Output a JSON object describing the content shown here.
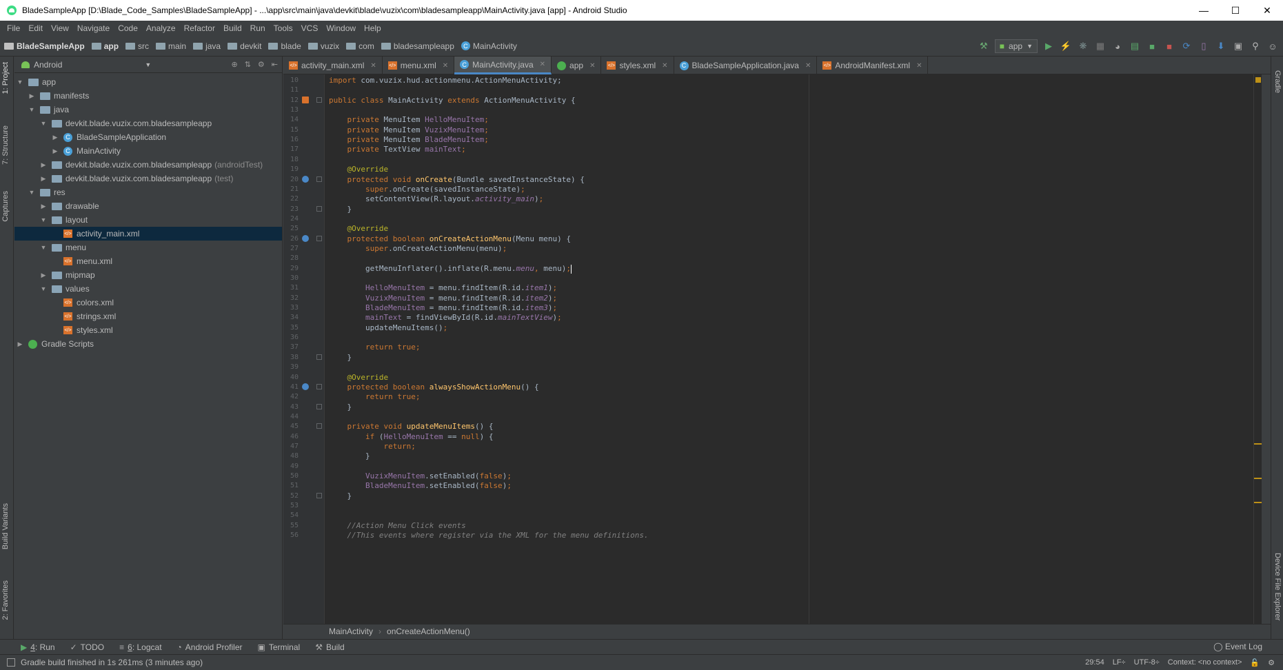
{
  "window": {
    "title": "BladeSampleApp [D:\\Blade_Code_Samples\\BladeSampleApp] - ...\\app\\src\\main\\java\\devkit\\blade\\vuzix\\com\\bladesampleapp\\MainActivity.java [app] - Android Studio",
    "minimize": "—",
    "maximize": "☐",
    "close": "✕"
  },
  "menu": [
    "File",
    "Edit",
    "View",
    "Navigate",
    "Code",
    "Analyze",
    "Refactor",
    "Build",
    "Run",
    "Tools",
    "VCS",
    "Window",
    "Help"
  ],
  "breadcrumbs": [
    "BladeSampleApp",
    "app",
    "src",
    "main",
    "java",
    "devkit",
    "blade",
    "vuzix",
    "com",
    "bladesampleapp",
    "MainActivity"
  ],
  "toolbar": {
    "run_config": "app"
  },
  "left_tool_tabs": [
    "1: Project",
    "7: Structure",
    "Captures",
    "Build Variants",
    "2: Favorites"
  ],
  "right_tool_tabs": [
    "Gradle",
    "Device File Explorer"
  ],
  "project": {
    "view_mode": "Android",
    "tree": [
      {
        "label": "app",
        "depth": 0,
        "type": "folder",
        "open": true
      },
      {
        "label": "manifests",
        "depth": 1,
        "type": "folder",
        "open": false
      },
      {
        "label": "java",
        "depth": 1,
        "type": "folder",
        "open": true
      },
      {
        "label": "devkit.blade.vuzix.com.bladesampleapp",
        "depth": 2,
        "type": "pkg",
        "open": true
      },
      {
        "label": "BladeSampleApplication",
        "depth": 3,
        "type": "class",
        "open": false
      },
      {
        "label": "MainActivity",
        "depth": 3,
        "type": "class",
        "open": false
      },
      {
        "label": "devkit.blade.vuzix.com.bladesampleapp",
        "suffix": "(androidTest)",
        "depth": 2,
        "type": "pkg",
        "open": false
      },
      {
        "label": "devkit.blade.vuzix.com.bladesampleapp",
        "suffix": "(test)",
        "depth": 2,
        "type": "pkg",
        "open": false
      },
      {
        "label": "res",
        "depth": 1,
        "type": "folder",
        "open": true
      },
      {
        "label": "drawable",
        "depth": 2,
        "type": "folder",
        "open": false
      },
      {
        "label": "layout",
        "depth": 2,
        "type": "folder",
        "open": true
      },
      {
        "label": "activity_main.xml",
        "depth": 3,
        "type": "xml",
        "selected": true
      },
      {
        "label": "menu",
        "depth": 2,
        "type": "folder",
        "open": true
      },
      {
        "label": "menu.xml",
        "depth": 3,
        "type": "xml"
      },
      {
        "label": "mipmap",
        "depth": 2,
        "type": "folder",
        "open": false
      },
      {
        "label": "values",
        "depth": 2,
        "type": "folder",
        "open": true
      },
      {
        "label": "colors.xml",
        "depth": 3,
        "type": "xml"
      },
      {
        "label": "strings.xml",
        "depth": 3,
        "type": "xml"
      },
      {
        "label": "styles.xml",
        "depth": 3,
        "type": "xml"
      },
      {
        "label": "Gradle Scripts",
        "depth": 0,
        "type": "gradle",
        "open": false
      }
    ]
  },
  "editor_tabs": [
    {
      "label": "activity_main.xml",
      "icon": "xml"
    },
    {
      "label": "menu.xml",
      "icon": "xml"
    },
    {
      "label": "MainActivity.java",
      "icon": "class",
      "active": true
    },
    {
      "label": "app",
      "icon": "gradle"
    },
    {
      "label": "styles.xml",
      "icon": "xml"
    },
    {
      "label": "BladeSampleApplication.java",
      "icon": "class"
    },
    {
      "label": "AndroidManifest.xml",
      "icon": "xml"
    }
  ],
  "code_lines": [
    {
      "n": "10",
      "html": "<span class='kw'>import</span> <span class='tx'>com.vuzix.hud.actionmenu.ActionMenuActivity;</span>"
    },
    {
      "n": "11",
      "html": ""
    },
    {
      "n": "12",
      "html": "<span class='kw'>public class</span> <span class='tx'>MainActivity</span> <span class='kw'>extends</span> <span class='tx'>ActionMenuActivity {</span>"
    },
    {
      "n": "13",
      "html": ""
    },
    {
      "n": "14",
      "html": "    <span class='kw'>private</span> <span class='tx'>MenuItem</span> <span class='fld'>HelloMenuItem</span><span class='kw'>;</span>"
    },
    {
      "n": "15",
      "html": "    <span class='kw'>private</span> <span class='tx'>MenuItem</span> <span class='fld'>VuzixMenuItem</span><span class='kw'>;</span>"
    },
    {
      "n": "16",
      "html": "    <span class='kw'>private</span> <span class='tx'>MenuItem</span> <span class='fld'>BladeMenuItem</span><span class='kw'>;</span>"
    },
    {
      "n": "17",
      "html": "    <span class='kw'>private</span> <span class='tx'>TextView</span> <span class='fld'>mainText</span><span class='kw'>;</span>"
    },
    {
      "n": "18",
      "html": ""
    },
    {
      "n": "19",
      "html": "    <span class='ann'>@Override</span>"
    },
    {
      "n": "20",
      "html": "    <span class='kw'>protected void</span> <span class='fn'>onCreate</span><span class='tx'>(Bundle savedInstanceState) {</span>"
    },
    {
      "n": "21",
      "html": "        <span class='kw'>super</span><span class='tx'>.onCreate(savedInstanceState)</span><span class='kw'>;</span>"
    },
    {
      "n": "22",
      "html": "        <span class='tx'>setContentView(R.layout.</span><span class='it'>activity_main</span><span class='tx'>)</span><span class='kw'>;</span>"
    },
    {
      "n": "23",
      "html": "    <span class='tx'>}</span>"
    },
    {
      "n": "24",
      "html": ""
    },
    {
      "n": "25",
      "html": "    <span class='ann'>@Override</span>"
    },
    {
      "n": "26",
      "html": "    <span class='kw'>protected boolean</span> <span class='fn'>onCreateActionMenu</span><span class='tx'>(Menu menu) {</span>"
    },
    {
      "n": "27",
      "html": "        <span class='kw'>super</span><span class='tx'>.onCreateActionMenu(menu)</span><span class='kw'>;</span>"
    },
    {
      "n": "28",
      "html": ""
    },
    {
      "n": "29",
      "html": "        <span class='tx'>getMenuInflater().inflate(R.menu.</span><span class='it'>menu</span><span class='kw'>,</span> <span class='tx'>menu)</span><span class='kw'>;</span><span class='caret'></span>"
    },
    {
      "n": "30",
      "html": ""
    },
    {
      "n": "31",
      "html": "        <span class='fld'>HelloMenuItem</span> <span class='tx'>= menu.findItem(R.id.</span><span class='it'>item1</span><span class='tx'>)</span><span class='kw'>;</span>"
    },
    {
      "n": "32",
      "html": "        <span class='fld'>VuzixMenuItem</span> <span class='tx'>= menu.findItem(R.id.</span><span class='it'>item2</span><span class='tx'>)</span><span class='kw'>;</span>"
    },
    {
      "n": "33",
      "html": "        <span class='fld'>BladeMenuItem</span> <span class='tx'>= menu.findItem(R.id.</span><span class='it'>item3</span><span class='tx'>)</span><span class='kw'>;</span>"
    },
    {
      "n": "34",
      "html": "        <span class='fld'>mainText</span> <span class='tx'>= findViewById(R.id.</span><span class='it'>mainTextView</span><span class='tx'>)</span><span class='kw'>;</span>"
    },
    {
      "n": "35",
      "html": "        <span class='tx'>updateMenuItems()</span><span class='kw'>;</span>"
    },
    {
      "n": "36",
      "html": ""
    },
    {
      "n": "37",
      "html": "        <span class='kw'>return true;</span>"
    },
    {
      "n": "38",
      "html": "    <span class='tx'>}</span>"
    },
    {
      "n": "39",
      "html": ""
    },
    {
      "n": "40",
      "html": "    <span class='ann'>@Override</span>"
    },
    {
      "n": "41",
      "html": "    <span class='kw'>protected boolean</span> <span class='fn'>alwaysShowActionMenu</span><span class='tx'>() {</span>"
    },
    {
      "n": "42",
      "html": "        <span class='kw'>return true;</span>"
    },
    {
      "n": "43",
      "html": "    <span class='tx'>}</span>"
    },
    {
      "n": "44",
      "html": ""
    },
    {
      "n": "45",
      "html": "    <span class='kw'>private void</span> <span class='fn'>updateMenuItems</span><span class='tx'>() {</span>"
    },
    {
      "n": "46",
      "html": "        <span class='kw'>if</span> <span class='tx'>(</span><span class='fld'>HelloMenuItem</span> <span class='tx'>==</span> <span class='kw'>null</span><span class='tx'>) {</span>"
    },
    {
      "n": "47",
      "html": "            <span class='kw'>return;</span>"
    },
    {
      "n": "48",
      "html": "        <span class='tx'>}</span>"
    },
    {
      "n": "49",
      "html": ""
    },
    {
      "n": "50",
      "html": "        <span class='fld'>VuzixMenuItem</span><span class='tx'>.setEnabled(</span><span class='kw'>false</span><span class='tx'>)</span><span class='kw'>;</span>"
    },
    {
      "n": "51",
      "html": "        <span class='fld'>BladeMenuItem</span><span class='tx'>.setEnabled(</span><span class='kw'>false</span><span class='tx'>)</span><span class='kw'>;</span>"
    },
    {
      "n": "52",
      "html": "    <span class='tx'>}</span>"
    },
    {
      "n": "53",
      "html": ""
    },
    {
      "n": "54",
      "html": ""
    },
    {
      "n": "55",
      "html": "    <span class='cm'>//Action Menu Click events</span>"
    },
    {
      "n": "56",
      "html": "    <span class='cm'>//This events where register via the XML for the menu definitions.</span>"
    }
  ],
  "editor_breadcrumb": [
    "MainActivity",
    "onCreateActionMenu()"
  ],
  "bottom_tools": [
    {
      "key": "4",
      "label": ": Run"
    },
    {
      "key": "",
      "label": "TODO"
    },
    {
      "key": "6",
      "label": ": Logcat"
    },
    {
      "key": "",
      "label": "Android Profiler"
    },
    {
      "key": "",
      "label": "Terminal"
    },
    {
      "key": "",
      "label": "Build"
    }
  ],
  "event_log": "Event Log",
  "status": {
    "message": "Gradle build finished in 1s 261ms (3 minutes ago)",
    "position": "29:54",
    "line_sep": "LF÷",
    "encoding": "UTF-8÷",
    "context": "Context: <no context>"
  }
}
